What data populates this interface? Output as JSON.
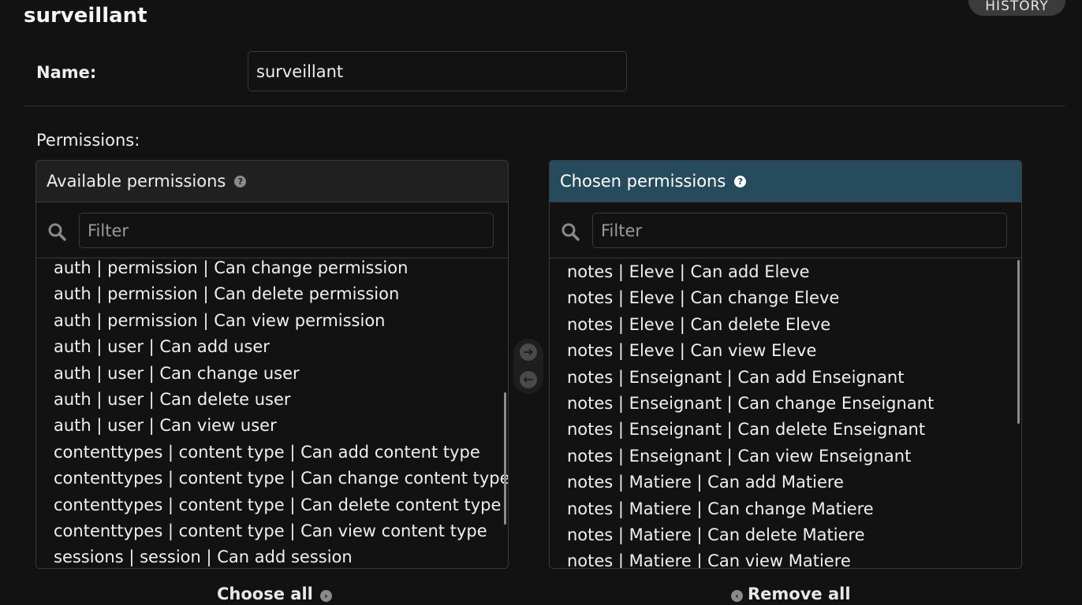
{
  "page": {
    "title": "surveillant",
    "history_label": "HISTORY"
  },
  "form": {
    "name_label": "Name:",
    "name_value": "surveillant",
    "permissions_label": "Permissions:"
  },
  "available": {
    "title": "Available permissions",
    "help_glyph": "?",
    "filter_placeholder": "Filter",
    "items": [
      "auth | permission | Can change permission",
      "auth | permission | Can delete permission",
      "auth | permission | Can view permission",
      "auth | user | Can add user",
      "auth | user | Can change user",
      "auth | user | Can delete user",
      "auth | user | Can view user",
      "contenttypes | content type | Can add content type",
      "contenttypes | content type | Can change content type",
      "contenttypes | content type | Can delete content type",
      "contenttypes | content type | Can view content type",
      "sessions | session | Can add session"
    ],
    "choose_all_label": "Choose all"
  },
  "chosen": {
    "title": "Chosen permissions",
    "help_glyph": "?",
    "filter_placeholder": "Filter",
    "items": [
      "notes | Eleve | Can add Eleve",
      "notes | Eleve | Can change Eleve",
      "notes | Eleve | Can delete Eleve",
      "notes | Eleve | Can view Eleve",
      "notes | Enseignant | Can add Enseignant",
      "notes | Enseignant | Can change Enseignant",
      "notes | Enseignant | Can delete Enseignant",
      "notes | Enseignant | Can view Enseignant",
      "notes | Matiere | Can add Matiere",
      "notes | Matiere | Can change Matiere",
      "notes | Matiere | Can delete Matiere",
      "notes | Matiere | Can view Matiere"
    ],
    "remove_all_label": "Remove all"
  },
  "icons": {
    "search": "search-icon",
    "help": "help-icon",
    "move_add": "arrow-right-icon",
    "move_remove": "arrow-left-icon",
    "choose_all": "arrow-right-circle-icon",
    "remove_all": "arrow-left-circle-icon"
  },
  "colors": {
    "background": "#121212",
    "chosen_header": "#264b5d",
    "border": "#3a3a3a"
  }
}
